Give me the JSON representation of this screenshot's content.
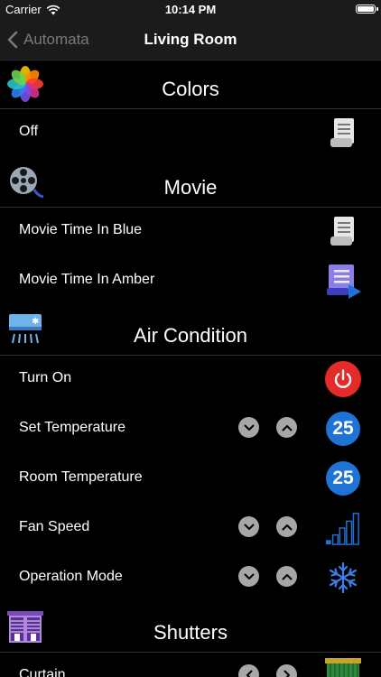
{
  "status": {
    "carrier": "Carrier",
    "time": "10:14 PM",
    "battery_level": 1.0
  },
  "nav": {
    "back_label": "Automata",
    "title": "Living Room"
  },
  "sections": {
    "colors": {
      "title": "Colors",
      "icon": "photos-flower-icon"
    },
    "movie": {
      "title": "Movie",
      "icon": "film-reel-icon"
    },
    "ac": {
      "title": "Air Condition",
      "icon": "air-conditioner-icon"
    },
    "shutters": {
      "title": "Shutters",
      "icon": "shutters-icon"
    }
  },
  "rows": {
    "off": {
      "label": "Off",
      "icon": "scroll-icon"
    },
    "movie_blue": {
      "label": "Movie Time In Blue",
      "icon": "scroll-icon"
    },
    "movie_amber": {
      "label": "Movie Time In Amber",
      "icon": "play-list-icon"
    },
    "turn_on": {
      "label": "Turn On",
      "icon": "power-icon"
    },
    "set_temp": {
      "label": "Set Temperature",
      "value": "25"
    },
    "room_temp": {
      "label": "Room Temperature",
      "value": "25"
    },
    "fan_speed": {
      "label": "Fan Speed",
      "icon": "signal-bars-icon"
    },
    "operation_mode": {
      "label": "Operation Mode",
      "icon": "snowflake-icon"
    },
    "curtain": {
      "label": "Curtain",
      "icon": "curtain-icon"
    }
  },
  "colors": {
    "accent_blue": "#1f73d6",
    "power_red": "#e52a2a",
    "stepper_gray": "#a7a7a7"
  }
}
